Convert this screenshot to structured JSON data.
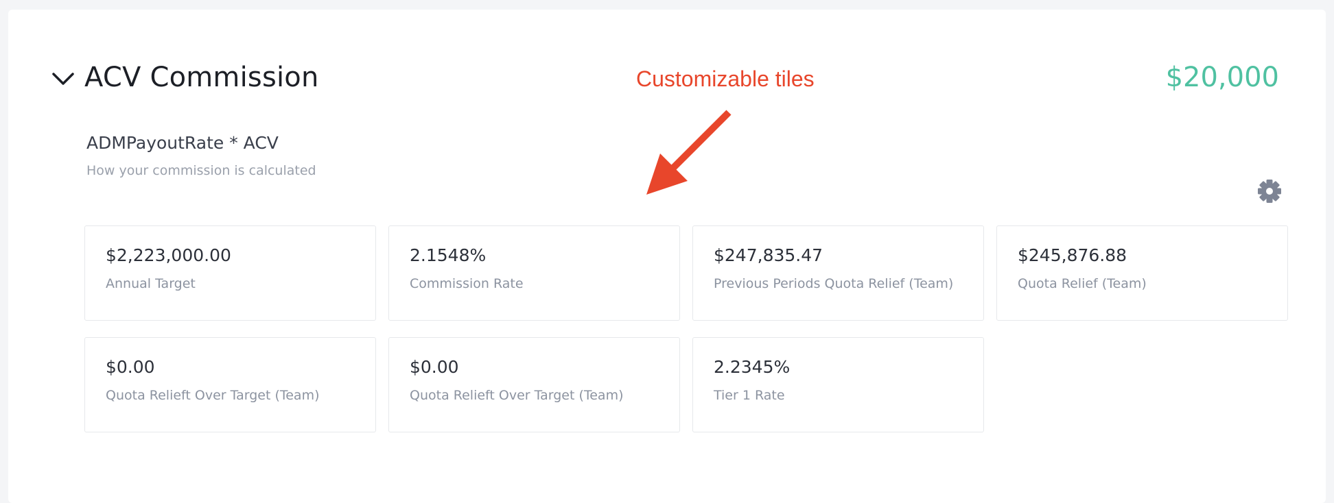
{
  "section": {
    "title": "ACV Commission",
    "total": "$20,000",
    "formula": "ADMPayoutRate * ACV",
    "formula_caption": "How your commission is calculated"
  },
  "annotation": {
    "text": "Customizable tiles",
    "color": "#e8462b"
  },
  "icons": {
    "collapse": "chevron-down-icon",
    "settings": "gear-icon"
  },
  "colors": {
    "total": "#4fc1a1",
    "title": "#1c1f26",
    "muted": "#9aa0ab"
  },
  "tiles": [
    {
      "value": "$2,223,000.00",
      "label": "Annual Target"
    },
    {
      "value": "2.1548%",
      "label": "Commission Rate"
    },
    {
      "value": "$247,835.47",
      "label": "Previous Periods Quota Relief (Team)"
    },
    {
      "value": "$245,876.88",
      "label": "Quota Relief (Team)"
    },
    {
      "value": "$0.00",
      "label": "Quota Relieft Over Target (Team)"
    },
    {
      "value": "$0.00",
      "label": "Quota Relieft Over Target (Team)"
    },
    {
      "value": "2.2345%",
      "label": "Tier 1 Rate"
    }
  ]
}
